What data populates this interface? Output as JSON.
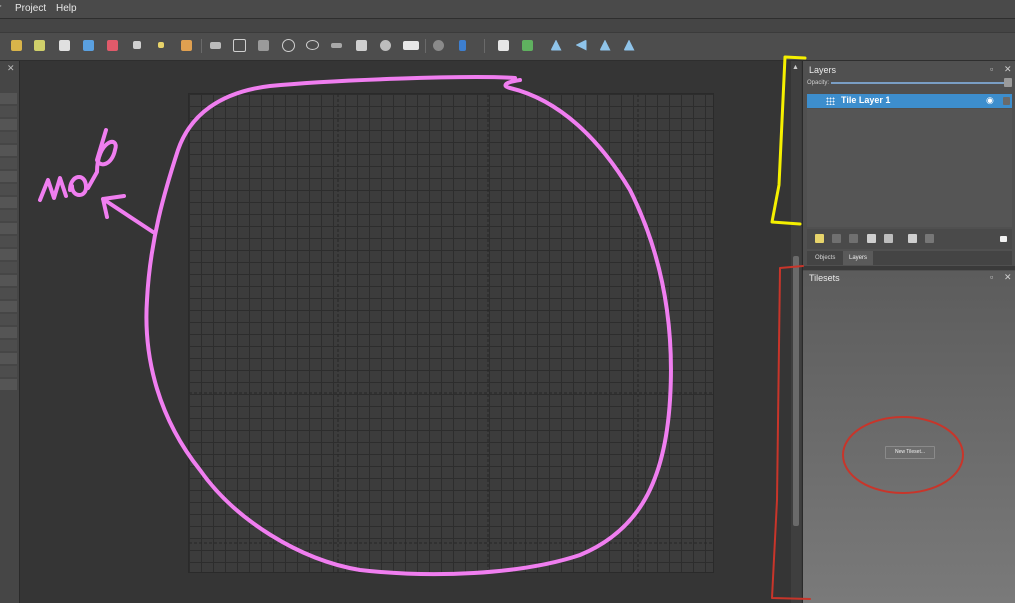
{
  "menu": {
    "items": [
      "r",
      "Project",
      "Help"
    ]
  },
  "layers_panel": {
    "title": "Layers",
    "opacity_label": "Opacity:",
    "opacity": 1.0,
    "layers": [
      {
        "name": "Tile Layer 1",
        "visible": true,
        "selected": true
      }
    ],
    "tabs": [
      "Objects",
      "Layers"
    ],
    "active_tab": "Layers"
  },
  "tilesets_panel": {
    "title": "Tilesets",
    "new_tileset_label": "New Tileset..."
  },
  "annotation": {
    "map_label": "map",
    "pink": "#f07ef0",
    "yellow": "#f5f000",
    "red": "#c8352a"
  },
  "toolbar": {
    "icons": [
      "stamp-brush-icon",
      "terrain-brush-icon",
      "bucket-fill-icon",
      "rectangle-select-icon",
      "eraser-icon",
      "rect-select-icon",
      "magic-wand-icon",
      "select-same-tile-icon",
      "insert-rectangle-icon",
      "insert-polygon-icon",
      "insert-shape-icon",
      "insert-point-icon",
      "insert-ellipse-icon",
      "insert-polyline-icon",
      "insert-tile-icon",
      "insert-template-icon",
      "insert-text-icon",
      "world-icon",
      "shape-fill-icon",
      "random-mode-icon",
      "wang-icon",
      "flip-horizontal-icon",
      "flip-vertical-icon",
      "rotate-left-icon",
      "rotate-right-icon"
    ]
  }
}
